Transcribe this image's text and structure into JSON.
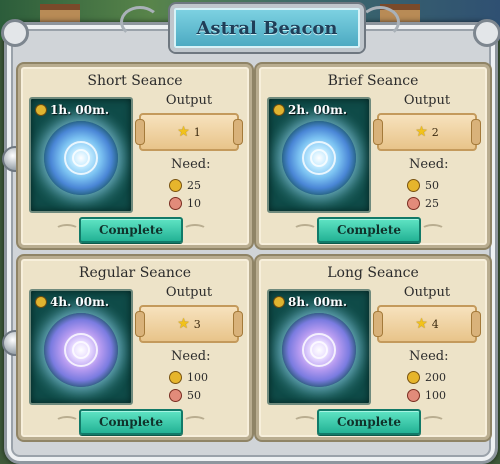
{
  "window": {
    "title": "Astral Beacon"
  },
  "seances": [
    {
      "name": "Short Seance",
      "time": "1h. 00m.",
      "output_label": "Output",
      "output_stars": "1",
      "need_label": "Need:",
      "cost_coins": "25",
      "cost_potions": "10",
      "button": "Complete",
      "portal_icon": "portal-icon"
    },
    {
      "name": "Brief Seance",
      "time": "2h. 00m.",
      "output_label": "Output",
      "output_stars": "2",
      "need_label": "Need:",
      "cost_coins": "50",
      "cost_potions": "25",
      "button": "Complete",
      "portal_icon": "portal-icon"
    },
    {
      "name": "Regular Seance",
      "time": "4h. 00m.",
      "output_label": "Output",
      "output_stars": "3",
      "need_label": "Need:",
      "cost_coins": "100",
      "cost_potions": "50",
      "button": "Complete",
      "portal_icon": "portal-icon"
    },
    {
      "name": "Long Seance",
      "time": "8h. 00m.",
      "output_label": "Output",
      "output_stars": "4",
      "need_label": "Need:",
      "cost_coins": "200",
      "cost_potions": "100",
      "button": "Complete",
      "portal_icon": "portal-icon"
    }
  ],
  "icons": {
    "timer": "timer-icon",
    "star": "star-icon",
    "coin": "coin-icon",
    "potion": "potion-icon"
  },
  "colors": {
    "button": "#23b295",
    "title_plate": "#4aa8c0",
    "panel": "#ede3c8"
  }
}
